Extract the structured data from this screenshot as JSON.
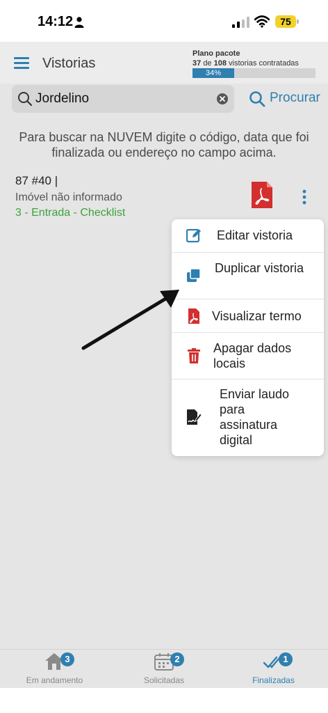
{
  "status_bar": {
    "time": "14:12",
    "battery": "75"
  },
  "header": {
    "title": "Vistorias",
    "plan_title": "Plano pacote",
    "plan_used": "37",
    "plan_of": "de",
    "plan_total": "108",
    "plan_suffix": "vistorias contratadas",
    "progress_label": "34%",
    "progress_fraction": 0.34
  },
  "search": {
    "value": "Jordelino",
    "button_label": "Procurar"
  },
  "hint": "Para buscar na NUVEM digite o código, data que foi finalizada ou endereço no campo acima.",
  "item": {
    "code": "87 #40 |",
    "address": "Imóvel não informado",
    "status": "3 - Entrada - Checklist"
  },
  "menu": {
    "edit": "Editar vistoria",
    "duplicate": "Duplicar vistoria",
    "view_term": "Visualizar termo",
    "delete_local": "Apagar dados locais",
    "send_signature": "Enviar laudo para assinatura digital"
  },
  "tabs": {
    "in_progress_label": "Em andamento",
    "in_progress_badge": "3",
    "requested_label": "Solicitadas",
    "requested_badge": "2",
    "finished_label": "Finalizadas",
    "finished_badge": "1"
  },
  "colors": {
    "accent": "#2f7fb0",
    "status_green": "#3ca33c",
    "pdf_red": "#d32f2f",
    "battery_yellow": "#f2d12b"
  }
}
